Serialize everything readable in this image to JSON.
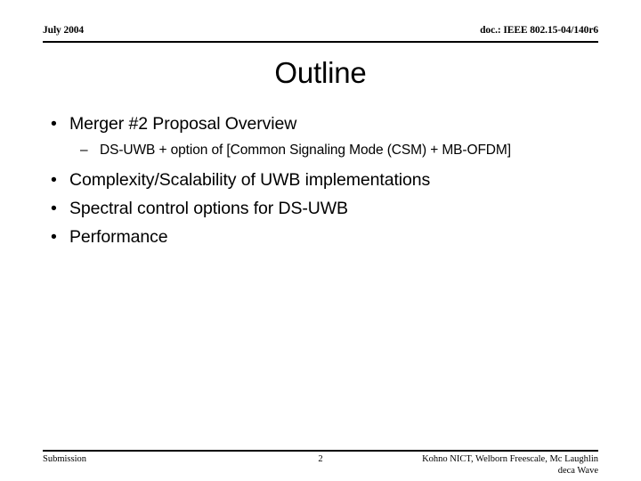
{
  "header": {
    "left": "July 2004",
    "right": "doc.: IEEE 802.15-04/140r6"
  },
  "title": "Outline",
  "bullets": [
    {
      "level": 1,
      "marker": "•",
      "text": "Merger #2 Proposal Overview"
    },
    {
      "level": 2,
      "marker": "–",
      "text": "DS-UWB + option of [Common Signaling Mode (CSM) + MB-OFDM]"
    },
    {
      "level": 1,
      "marker": "•",
      "text": "Complexity/Scalability of UWB implementations"
    },
    {
      "level": 1,
      "marker": "•",
      "text": "Spectral control options for DS-UWB"
    },
    {
      "level": 1,
      "marker": "•",
      "text": "Performance"
    }
  ],
  "footer": {
    "left": "Submission",
    "page_number": "2",
    "right_line1": "Kohno NICT, Welborn Freescale, Mc Laughlin",
    "right_line2": "deca Wave"
  },
  "colors": {
    "text": "#000000",
    "background": "#ffffff",
    "rule": "#000000"
  }
}
